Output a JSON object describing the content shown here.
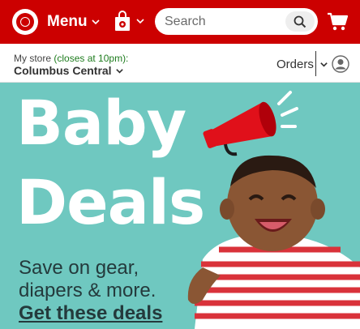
{
  "header": {
    "menu_label": "Menu",
    "search_placeholder": "Search",
    "icons": {
      "logo": "target-bullseye-logo",
      "menu_chevron": "chevron-down-icon",
      "bag": "shopping-bag-icon",
      "search": "search-icon",
      "cart": "cart-icon"
    },
    "colors": {
      "brand_red": "#cc0000"
    }
  },
  "store": {
    "label": "My store",
    "hours": "(closes at 10pm):",
    "name": "Columbus Central",
    "orders_label": "Orders"
  },
  "hero": {
    "title_line1": "Baby",
    "title_line2": "Deals",
    "subtitle_line1": "Save on gear,",
    "subtitle_line2": "diapers & more.",
    "cta": "Get these deals",
    "colors": {
      "background": "#6fc8c0",
      "title": "#ffffff",
      "text": "#243a3c"
    }
  }
}
